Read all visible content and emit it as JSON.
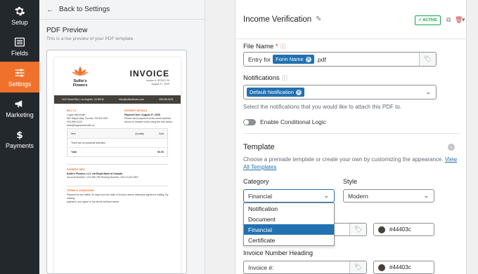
{
  "nav": {
    "items": [
      {
        "label": "Setup",
        "icon": "gear-icon"
      },
      {
        "label": "Fields",
        "icon": "fields-icon"
      },
      {
        "label": "Settings",
        "icon": "sliders-icon",
        "active": true
      },
      {
        "label": "Marketing",
        "icon": "megaphone-icon"
      },
      {
        "label": "Payments",
        "icon": "dollar-icon"
      }
    ]
  },
  "preview": {
    "back_label": "Back to Settings",
    "title": "PDF Preview",
    "subtitle": "This is a live preview of your PDF template.",
    "pdf": {
      "logo_name": "Sullie's Flowers",
      "invoice_title": "INVOICE",
      "invoice_number": "Invoice #: SF0001 25",
      "invoice_date": "August 27, 2025",
      "band_address": "1234 Sunset Blvd, Los Angeles, CA 90026",
      "band_email": "hello@sulliesflowers.com",
      "band_phone": "555-000-5678",
      "bill_to_label": "BILL TO",
      "bill_to_name": "Logan McKendle",
      "bill_to_line1": "587 Maple Way, Toronto, ON M4 2N5",
      "bill_to_line2": "416-555-0123",
      "bill_to_line3": "hello@loganmckendle.ca",
      "payment_details_label": "PAYMENT DETAILS",
      "payment_due": "Payment Due: August 27, 2025",
      "payment_note1": "Please send payment to the email address",
      "payment_note2": "above or transfer funds using the info below.",
      "table_item": "Item",
      "table_qty": "Quantity",
      "table_total": "Total",
      "table_empty": "There are no products selected.",
      "table_total_label": "Total",
      "table_total_value": "$0.00",
      "payment_info_label": "PAYMENT INFO",
      "payment_info1": "Sullie's Flowers, LLC via Royal Bank of Canada",
      "payment_info2": "Account Number: 123-456-789  Routing Number: 4321-0123-4567",
      "terms_label": "TERMS & CONDITIONS",
      "terms1": "Payment is due within 30 days from the date of invoice unless otherwise agreed in writing. By making",
      "terms2": "payment, you agree to the terms outlined herein."
    }
  },
  "panel": {
    "title": "Income Verification",
    "status_badge": "✓ ACTIVE",
    "file_name_label": "File Name",
    "file_name_prefix": "Entry for",
    "file_name_tag": "Form Name",
    "file_name_suffix": ".pdf",
    "notifications_label": "Notifications",
    "notifications_tag": "Default Notification",
    "notifications_desc": "Select the notifications that you would like to attach this PDF to.",
    "conditional_logic_label": "Enable Conditional Logic",
    "template_title": "Template",
    "template_desc": "Choose a premade template or create your own by customizing the appearance.",
    "template_link": "View All Templates",
    "category_label": "Category",
    "category_value": "Financial",
    "category_options": [
      "Notification",
      "Document",
      "Financial",
      "Certificate"
    ],
    "category_selected_index": 2,
    "style_label": "Style",
    "style_value": "Modern",
    "color_value_1": "#44403c",
    "invoice_heading_label": "Invoice Number Heading",
    "invoice_heading_value": "Invoice #:",
    "color_value_2": "#44403c"
  },
  "colors": {
    "accent": "#f0712c",
    "sidebar": "#23282d",
    "link": "#2271b1",
    "active_badge": "#22a35a",
    "template_dark": "#44403c"
  }
}
